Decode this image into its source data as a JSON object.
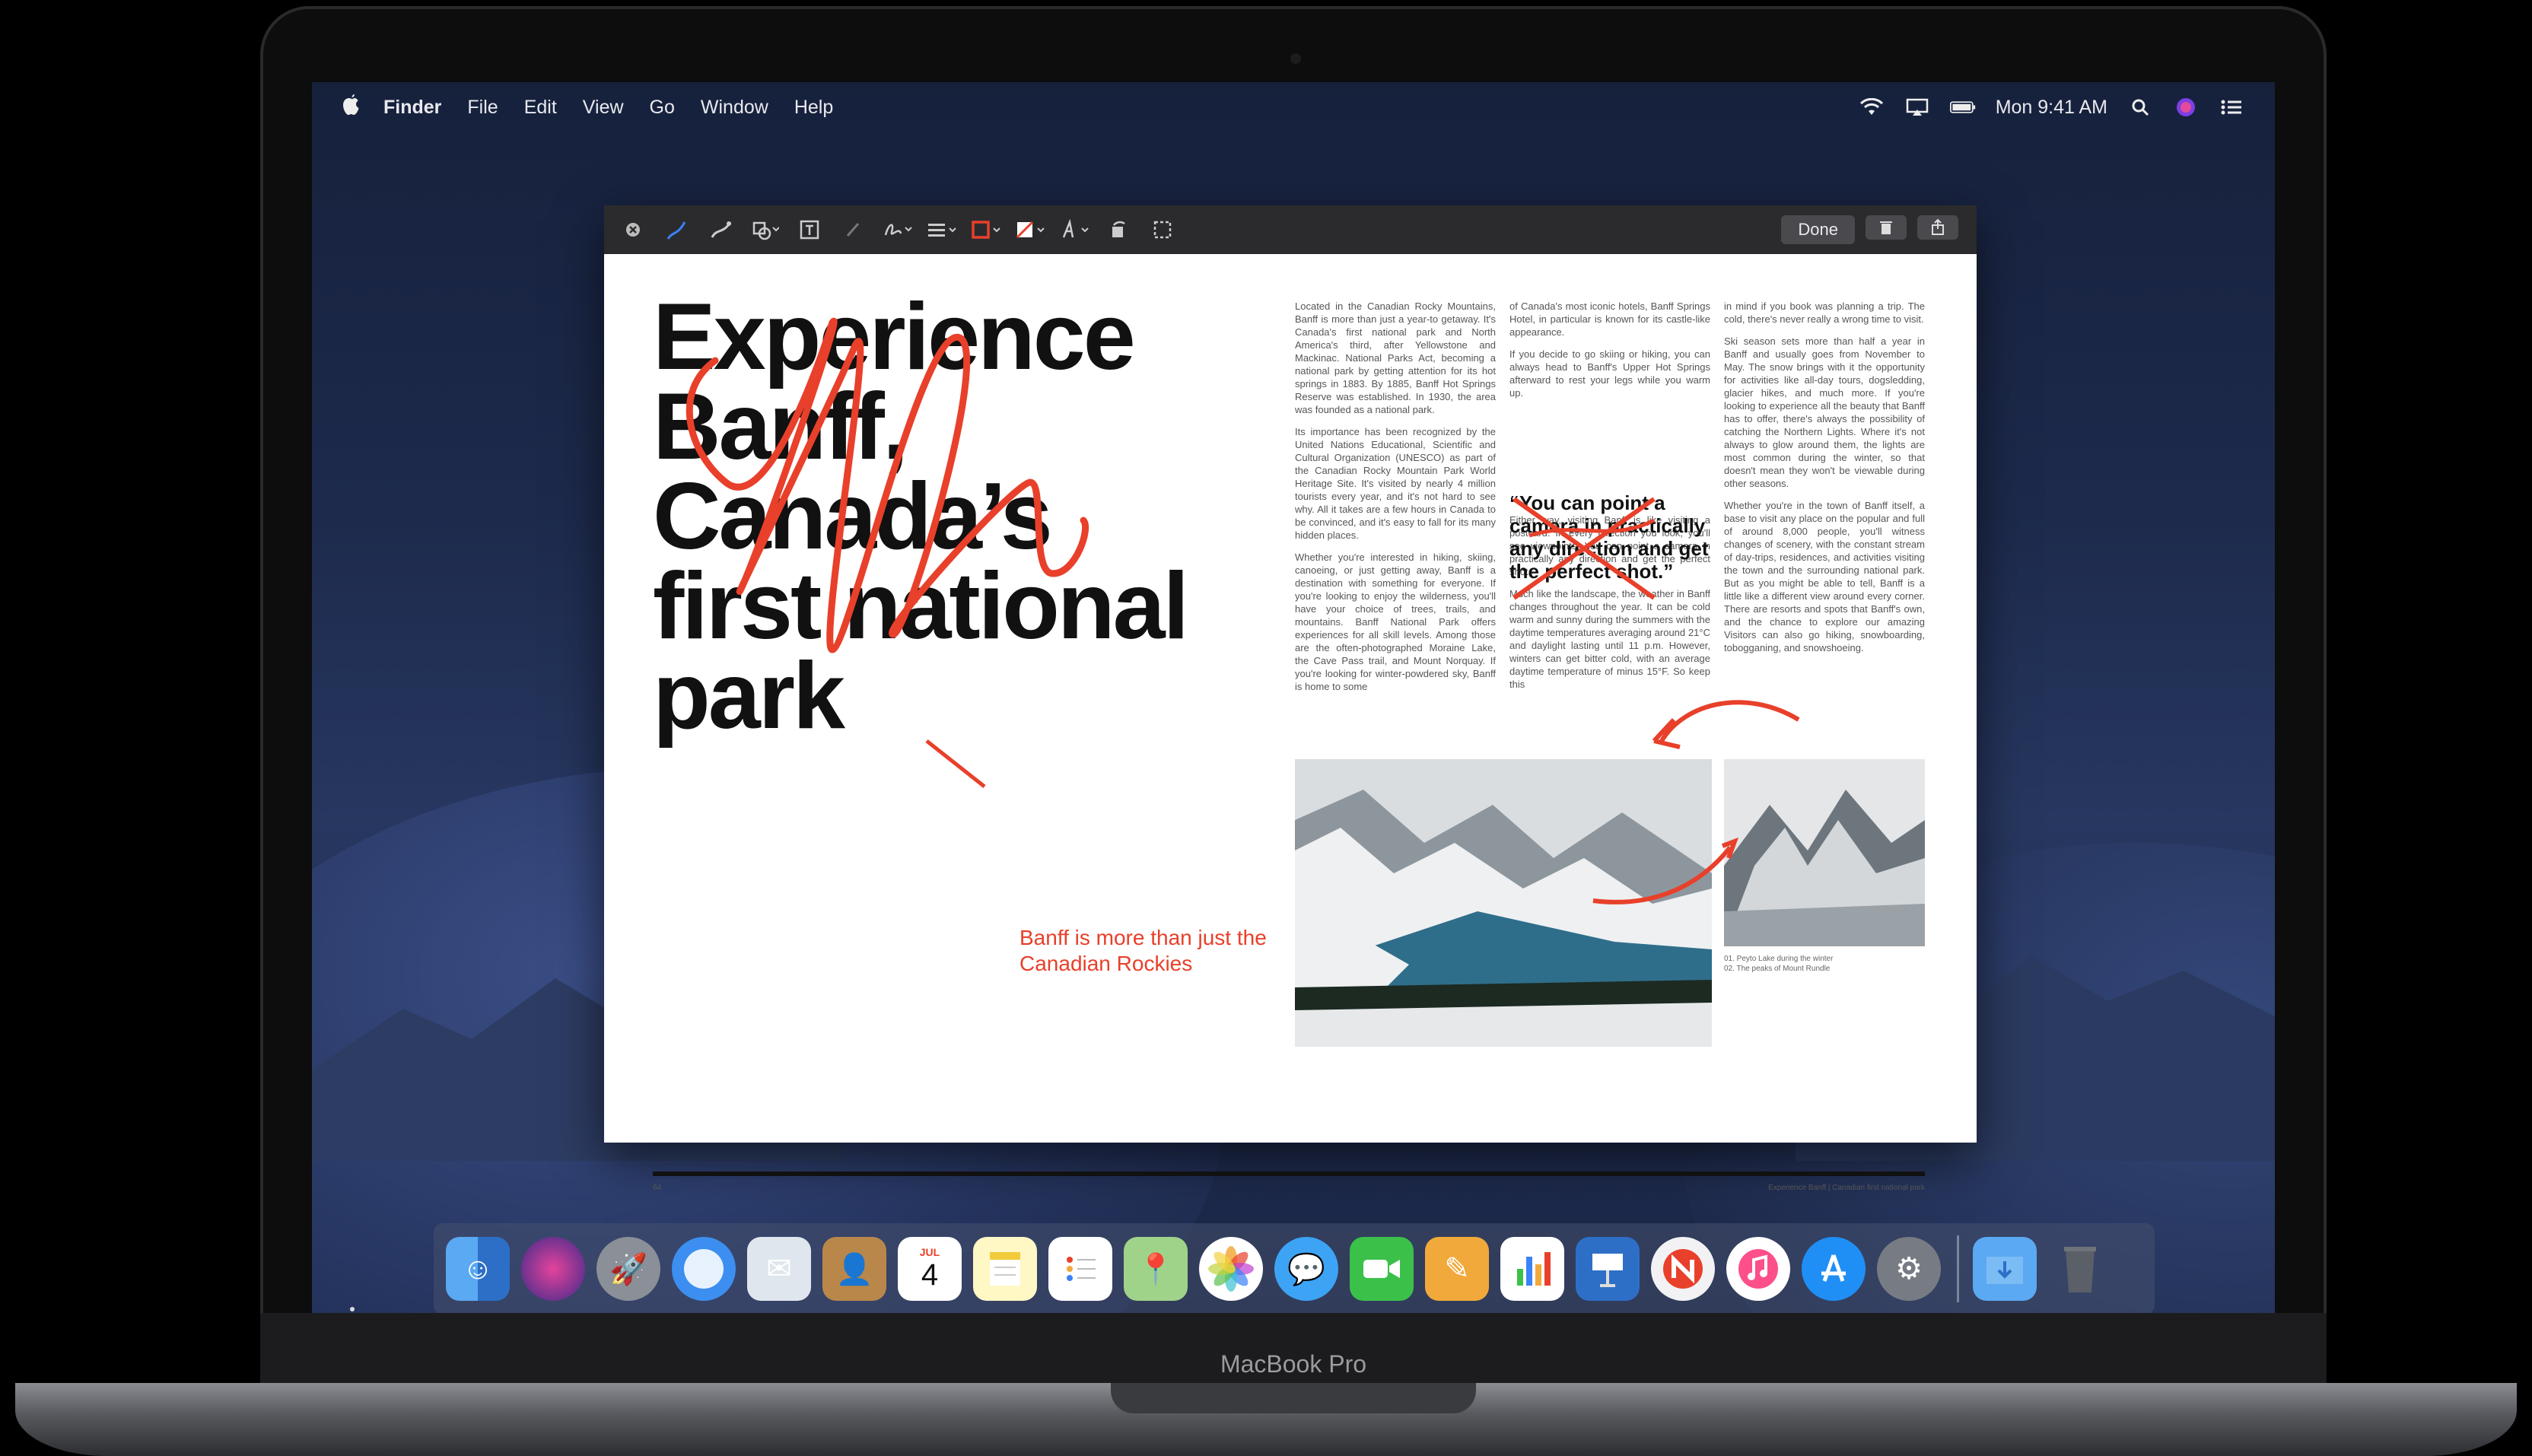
{
  "menubar": {
    "apple": "",
    "items": [
      "Finder",
      "File",
      "Edit",
      "View",
      "Go",
      "Window",
      "Help"
    ],
    "clock": "Mon 9:41 AM"
  },
  "toolbar": {
    "done_label": "Done",
    "tools": [
      "close-icon",
      "sketch-icon",
      "draw-icon",
      "shapes-icon",
      "text-icon",
      "highlight-icon",
      "sign-icon",
      "line-style-icon",
      "border-color-icon",
      "fill-color-icon",
      "text-style-icon",
      "rotate-icon",
      "crop-icon"
    ]
  },
  "document": {
    "headline": "Experience Banff, Canada’s first national park",
    "quote": "“You can point a camera in practically any direction and get the perfect shot.”",
    "annotation": "Banff is more than just the Canadian Rockies",
    "col1": [
      "Located in the Canadian Rocky Mountains, Banff is more than just a year-to getaway. It's Canada's first national park and North America's third, after Yellowstone and Mackinac. National Parks Act, becoming a national park by getting attention for its hot springs in 1883. By 1885, Banff Hot Springs Reserve was established. In 1930, the area was founded as a national park.",
      "Its importance has been recognized by the United Nations Educational, Scientific and Cultural Organization (UNESCO) as part of the Canadian Rocky Mountain Park World Heritage Site. It's visited by nearly 4 million tourists every year, and it's not hard to see why. All it takes are a few hours in Canada to be convinced, and it's easy to fall for its many hidden places.",
      "Whether you're interested in hiking, skiing, canoeing, or just getting away, Banff is a destination with something for everyone. If you're looking to enjoy the wilderness, you'll have your choice of trees, trails, and mountains. Banff National Park offers experiences for all skill levels. Among those are the often-photographed Moraine Lake, the Cave Pass trail, and Mount Norquay. If you're looking for winter-powdered sky, Banff is home to some"
    ],
    "col2": [
      "of Canada's most iconic hotels, Banff Springs Hotel, in particular is known for its castle-like appearance.",
      "If you decide to go skiing or hiking, you can always head to Banff's Upper Hot Springs afterward to rest your legs while you warm up.",
      "Either way, visiting Banff is like visiting a postcard. In every direction you look, you'll see viewpoints. You can point a camera in practically any direction and get the perfect shot.",
      "Much like the landscape, the weather in Banff changes throughout the year. It can be cold warm and sunny during the summers with the daytime temperatures averaging around 21°C and daylight lasting until 11 p.m. However, winters can get bitter cold, with an average daytime temperature of minus 15°F. So keep this"
    ],
    "col3": [
      "in mind if you book was planning a trip. The cold, there's never really a wrong time to visit.",
      "Ski season sets more than half a year in Banff and usually goes from November to May. The snow brings with it the opportunity for activities like all-day tours, dogsledding, glacier hikes, and much more. If you're looking to experience all the beauty that Banff has to offer, there's always the possibility of catching the Northern Lights. Where it's not always to glow around them, the lights are most common during the winter, so that doesn't mean they won't be viewable during other seasons.",
      "Whether you're in the town of Banff itself, a base to visit any place on the popular and full of around 8,000 people, you'll witness changes of scenery, with the constant stream of day-trips, residences, and activities visiting the town and the surrounding national park. But as you might be able to tell, Banff is a little like a different view around every corner. There are resorts and spots that Banff's own, and the chance to explore our amazing Visitors can also go hiking, snowboarding, tobogganing, and snowshoeing."
    ],
    "caption": "01. Peyto Lake during the winter\n02. The peaks of Mount Rundle",
    "footer_left": "64",
    "footer_right": "Experience Banff | Canadian first national park"
  },
  "dock": {
    "apps": [
      "Finder",
      "Siri",
      "Launchpad",
      "Safari",
      "Mail",
      "Contacts",
      "Calendar",
      "Notes",
      "Reminders",
      "Maps",
      "Photos",
      "Messages",
      "FaceTime",
      "Pages",
      "Numbers",
      "Keynote",
      "News",
      "iTunes",
      "App Store",
      "System Preferences"
    ],
    "calendar_day": "4",
    "calendar_month": "JUL"
  },
  "laptop": {
    "label": "MacBook Pro"
  },
  "colors": {
    "annotation": "#e8402a",
    "accent": "#3b82f6"
  }
}
